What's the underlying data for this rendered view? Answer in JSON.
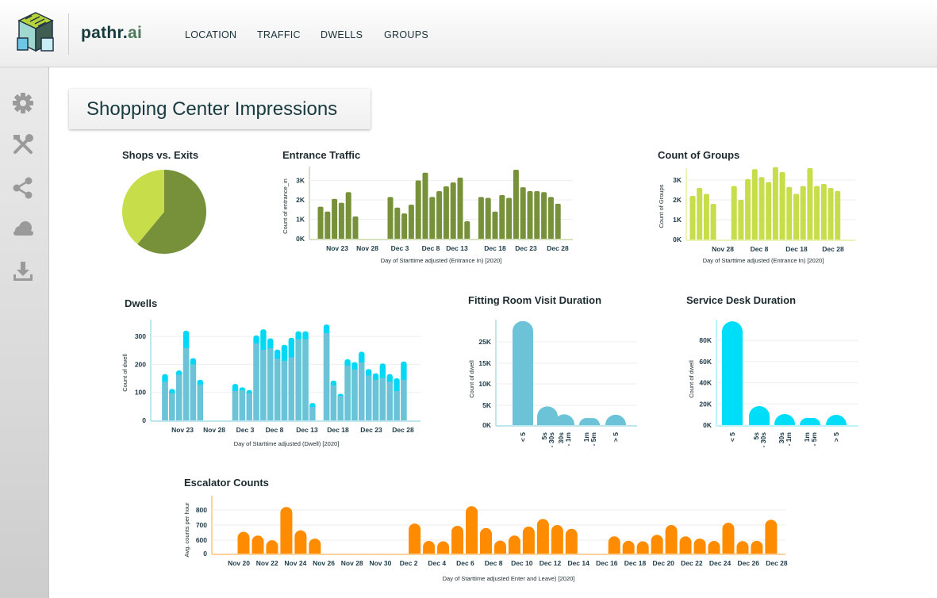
{
  "header": {
    "brand": "pathr.",
    "brand_suffix": "ai",
    "nav": [
      {
        "label": "LOCATION"
      },
      {
        "label": "TRAFFIC"
      },
      {
        "label": "DWELLS"
      },
      {
        "label": "GROUPS"
      }
    ]
  },
  "sidebar": {
    "icons": [
      "gear-icon",
      "tools-icon",
      "share-icon",
      "cloud-icon",
      "download-icon"
    ]
  },
  "page_title": "Shopping Center Impressions",
  "colors": {
    "entrance": "#76913a",
    "groups": "#c8dd4a",
    "dwell_base": "#6cc3d8",
    "dwell_top": "#00d8f5",
    "fitting": "#6cc3d8",
    "service": "#00ddf8",
    "escalator": "#ff8c00",
    "pie_dark": "#76913a",
    "pie_light": "#c8dd4a"
  },
  "chart_data": [
    {
      "id": "shops",
      "type": "pie",
      "title": "Shops vs. Exits",
      "values": [
        61,
        39
      ]
    },
    {
      "id": "entrance",
      "type": "bar",
      "title": "Entrance Traffic",
      "ylabel": "Count of entrance_in",
      "xlabel": "Day of Starttime adjusted (Entrance In) [2020]",
      "yticks": [
        "0K",
        "1K",
        "2K",
        "3K"
      ],
      "xticks": [
        "Nov 23",
        "Nov 28",
        "Dec 3",
        "Dec 8",
        "Dec 13",
        "Dec 18",
        "Dec 23",
        "Dec 28"
      ],
      "values": [
        1650,
        1400,
        2050,
        1850,
        2400,
        1150,
        null,
        null,
        null,
        null,
        2150,
        1600,
        1300,
        1750,
        3000,
        3400,
        2150,
        2450,
        2700,
        2900,
        3150,
        900,
        null,
        2150,
        2100,
        1400,
        2250,
        2100,
        3550,
        2650,
        2450,
        2450,
        2400,
        2150,
        1800
      ]
    },
    {
      "id": "groups",
      "type": "bar",
      "title": "Count of Groups",
      "ylabel": "Count of Groups",
      "xlabel": "Day of Starttime adjusted (Entrance In) [2020]",
      "yticks": [
        "0K",
        "1K",
        "2K",
        "3K"
      ],
      "xticks": [
        "Nov 28",
        "Dec 8",
        "Dec 18",
        "Dec 28"
      ],
      "values": [
        2200,
        2600,
        2300,
        1800,
        null,
        null,
        2700,
        2000,
        3050,
        3550,
        3150,
        2900,
        3650,
        3400,
        2650,
        2300,
        2700,
        3600,
        2700,
        2800,
        2600,
        2450
      ]
    },
    {
      "id": "dwells",
      "type": "bar",
      "stacked": true,
      "title": "Dwells",
      "ylabel": "Count of dwell",
      "xlabel": "Day of Starttime adjusted (Dwell) [2020]",
      "yticks": [
        "0",
        "100",
        "200",
        "300"
      ],
      "xticks": [
        "Nov 23",
        "Nov 28",
        "Dec 3",
        "Dec 8",
        "Dec 13",
        "Dec 18",
        "Dec 23",
        "Dec 28"
      ],
      "base": [
        138,
        97,
        163,
        258,
        200,
        128,
        null,
        null,
        null,
        null,
        105,
        107,
        97,
        275,
        252,
        258,
        220,
        213,
        225,
        290,
        290,
        48,
        null,
        312,
        125,
        87,
        195,
        182,
        207,
        160,
        145,
        152,
        138,
        105,
        145
      ],
      "total": [
        165,
        112,
        178,
        320,
        222,
        145,
        null,
        null,
        null,
        null,
        130,
        118,
        108,
        303,
        325,
        293,
        253,
        270,
        295,
        318,
        318,
        62,
        null,
        342,
        142,
        95,
        218,
        208,
        245,
        183,
        168,
        203,
        165,
        150,
        210
      ]
    },
    {
      "id": "fitting",
      "type": "bar",
      "title": "Fitting Room Visit Duration",
      "ylabel": "Count of dwell",
      "yticks": [
        "0K",
        "5K",
        "10K",
        "15K",
        "25K"
      ],
      "categories": [
        "< 5",
        "5s - 30s",
        "30s - 1m",
        "1m - 5m",
        "> 5"
      ],
      "values": [
        30000,
        4500,
        2600,
        1700,
        2500
      ]
    },
    {
      "id": "service",
      "type": "bar",
      "title": "Service Desk Duration",
      "ylabel": "Count of dwell",
      "yticks": [
        "0K",
        "20K",
        "40K",
        "60K",
        "80K"
      ],
      "categories": [
        "< 5",
        "5s - 30s",
        "30s - 1m",
        "1m - 5m",
        "> 5"
      ],
      "values": [
        98000,
        18000,
        10500,
        6700,
        9700
      ]
    },
    {
      "id": "escalator",
      "type": "bar",
      "title": "Escalator Counts",
      "ylabel": "Avg. counts per hour",
      "xlabel": "Day of Starttime adjusted Enter and Leave) [2020]",
      "yticks": [
        "0",
        "600",
        "700",
        "800"
      ],
      "xticks": [
        "Nov 20",
        "Nov 22",
        "Nov 24",
        "Nov 26",
        "Nov 28",
        "Nov 30",
        "Dec 2",
        "Dec 4",
        "Dec 6",
        "Dec 8",
        "Dec 10",
        "Dec 12",
        "Dec 14",
        "Dec 16",
        "Dec 18",
        "Dec 20",
        "Dec 22",
        "Dec 24",
        "Dec 26",
        "Dec 28"
      ],
      "values": [
        655,
        630,
        595,
        820,
        665,
        610,
        null,
        null,
        null,
        null,
        null,
        null,
        710,
        565,
        545,
        695,
        825,
        680,
        580,
        630,
        690,
        740,
        700,
        675,
        null,
        null,
        625,
        570,
        545,
        635,
        700,
        625,
        610,
        565,
        715,
        555,
        570,
        735
      ]
    }
  ]
}
